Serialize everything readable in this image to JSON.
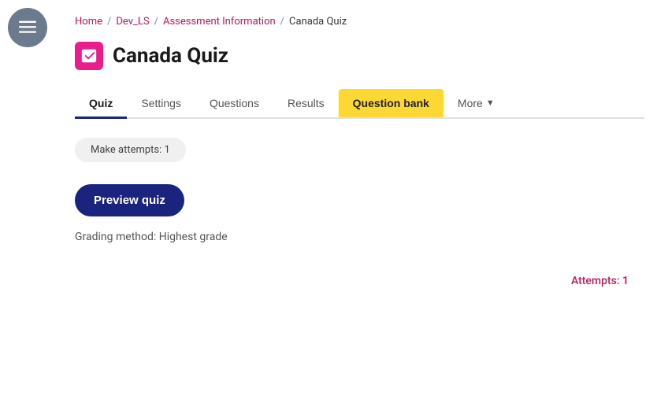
{
  "sidebar": {
    "btn_label": "Menu"
  },
  "breadcrumb": {
    "home": "Home",
    "dev_ls": "Dev_LS",
    "assessment": "Assessment Information",
    "current": "Canada Quiz",
    "sep": "/"
  },
  "page": {
    "title": "Canada Quiz",
    "icon_alt": "quiz-icon"
  },
  "tabs": [
    {
      "label": "Quiz",
      "active": true,
      "highlight": false
    },
    {
      "label": "Settings",
      "active": false,
      "highlight": false
    },
    {
      "label": "Questions",
      "active": false,
      "highlight": false
    },
    {
      "label": "Results",
      "active": false,
      "highlight": false
    },
    {
      "label": "Question bank",
      "active": false,
      "highlight": true
    },
    {
      "label": "More",
      "active": false,
      "highlight": false,
      "has_chevron": true
    }
  ],
  "attempt_banner": {
    "text": "Make attempts: 1"
  },
  "preview_btn": {
    "label": "Preview quiz"
  },
  "grading": {
    "text": "Grading method: Highest grade"
  },
  "attempts": {
    "text": "Attempts: 1"
  }
}
